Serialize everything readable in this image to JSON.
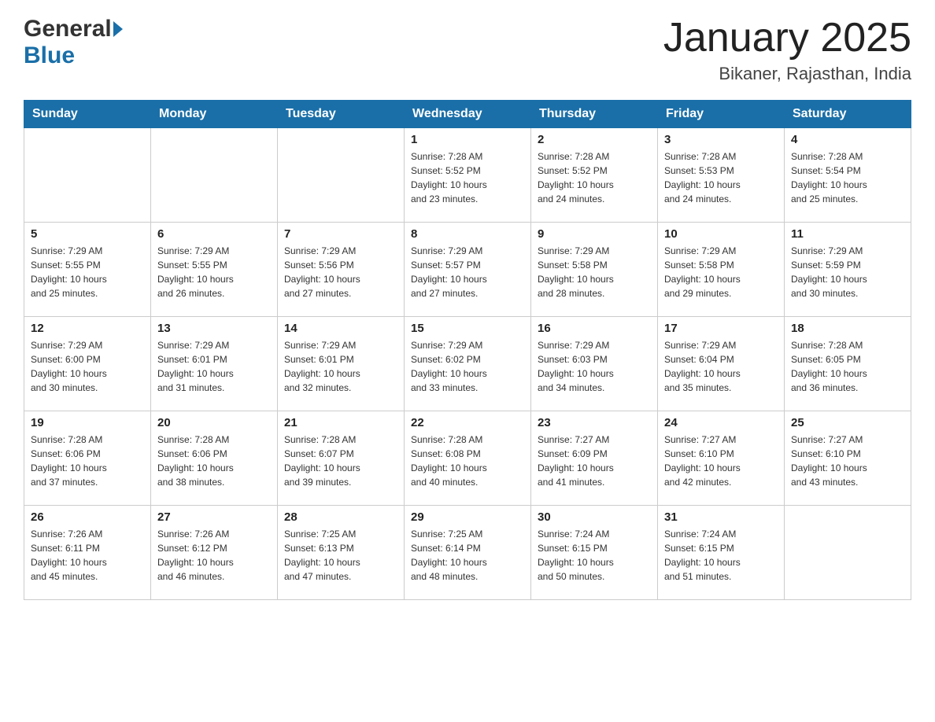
{
  "header": {
    "title": "January 2025",
    "subtitle": "Bikaner, Rajasthan, India",
    "logo_general": "General",
    "logo_blue": "Blue"
  },
  "days_of_week": [
    "Sunday",
    "Monday",
    "Tuesday",
    "Wednesday",
    "Thursday",
    "Friday",
    "Saturday"
  ],
  "weeks": [
    [
      {
        "day": "",
        "info": ""
      },
      {
        "day": "",
        "info": ""
      },
      {
        "day": "",
        "info": ""
      },
      {
        "day": "1",
        "info": "Sunrise: 7:28 AM\nSunset: 5:52 PM\nDaylight: 10 hours\nand 23 minutes."
      },
      {
        "day": "2",
        "info": "Sunrise: 7:28 AM\nSunset: 5:52 PM\nDaylight: 10 hours\nand 24 minutes."
      },
      {
        "day": "3",
        "info": "Sunrise: 7:28 AM\nSunset: 5:53 PM\nDaylight: 10 hours\nand 24 minutes."
      },
      {
        "day": "4",
        "info": "Sunrise: 7:28 AM\nSunset: 5:54 PM\nDaylight: 10 hours\nand 25 minutes."
      }
    ],
    [
      {
        "day": "5",
        "info": "Sunrise: 7:29 AM\nSunset: 5:55 PM\nDaylight: 10 hours\nand 25 minutes."
      },
      {
        "day": "6",
        "info": "Sunrise: 7:29 AM\nSunset: 5:55 PM\nDaylight: 10 hours\nand 26 minutes."
      },
      {
        "day": "7",
        "info": "Sunrise: 7:29 AM\nSunset: 5:56 PM\nDaylight: 10 hours\nand 27 minutes."
      },
      {
        "day": "8",
        "info": "Sunrise: 7:29 AM\nSunset: 5:57 PM\nDaylight: 10 hours\nand 27 minutes."
      },
      {
        "day": "9",
        "info": "Sunrise: 7:29 AM\nSunset: 5:58 PM\nDaylight: 10 hours\nand 28 minutes."
      },
      {
        "day": "10",
        "info": "Sunrise: 7:29 AM\nSunset: 5:58 PM\nDaylight: 10 hours\nand 29 minutes."
      },
      {
        "day": "11",
        "info": "Sunrise: 7:29 AM\nSunset: 5:59 PM\nDaylight: 10 hours\nand 30 minutes."
      }
    ],
    [
      {
        "day": "12",
        "info": "Sunrise: 7:29 AM\nSunset: 6:00 PM\nDaylight: 10 hours\nand 30 minutes."
      },
      {
        "day": "13",
        "info": "Sunrise: 7:29 AM\nSunset: 6:01 PM\nDaylight: 10 hours\nand 31 minutes."
      },
      {
        "day": "14",
        "info": "Sunrise: 7:29 AM\nSunset: 6:01 PM\nDaylight: 10 hours\nand 32 minutes."
      },
      {
        "day": "15",
        "info": "Sunrise: 7:29 AM\nSunset: 6:02 PM\nDaylight: 10 hours\nand 33 minutes."
      },
      {
        "day": "16",
        "info": "Sunrise: 7:29 AM\nSunset: 6:03 PM\nDaylight: 10 hours\nand 34 minutes."
      },
      {
        "day": "17",
        "info": "Sunrise: 7:29 AM\nSunset: 6:04 PM\nDaylight: 10 hours\nand 35 minutes."
      },
      {
        "day": "18",
        "info": "Sunrise: 7:28 AM\nSunset: 6:05 PM\nDaylight: 10 hours\nand 36 minutes."
      }
    ],
    [
      {
        "day": "19",
        "info": "Sunrise: 7:28 AM\nSunset: 6:06 PM\nDaylight: 10 hours\nand 37 minutes."
      },
      {
        "day": "20",
        "info": "Sunrise: 7:28 AM\nSunset: 6:06 PM\nDaylight: 10 hours\nand 38 minutes."
      },
      {
        "day": "21",
        "info": "Sunrise: 7:28 AM\nSunset: 6:07 PM\nDaylight: 10 hours\nand 39 minutes."
      },
      {
        "day": "22",
        "info": "Sunrise: 7:28 AM\nSunset: 6:08 PM\nDaylight: 10 hours\nand 40 minutes."
      },
      {
        "day": "23",
        "info": "Sunrise: 7:27 AM\nSunset: 6:09 PM\nDaylight: 10 hours\nand 41 minutes."
      },
      {
        "day": "24",
        "info": "Sunrise: 7:27 AM\nSunset: 6:10 PM\nDaylight: 10 hours\nand 42 minutes."
      },
      {
        "day": "25",
        "info": "Sunrise: 7:27 AM\nSunset: 6:10 PM\nDaylight: 10 hours\nand 43 minutes."
      }
    ],
    [
      {
        "day": "26",
        "info": "Sunrise: 7:26 AM\nSunset: 6:11 PM\nDaylight: 10 hours\nand 45 minutes."
      },
      {
        "day": "27",
        "info": "Sunrise: 7:26 AM\nSunset: 6:12 PM\nDaylight: 10 hours\nand 46 minutes."
      },
      {
        "day": "28",
        "info": "Sunrise: 7:25 AM\nSunset: 6:13 PM\nDaylight: 10 hours\nand 47 minutes."
      },
      {
        "day": "29",
        "info": "Sunrise: 7:25 AM\nSunset: 6:14 PM\nDaylight: 10 hours\nand 48 minutes."
      },
      {
        "day": "30",
        "info": "Sunrise: 7:24 AM\nSunset: 6:15 PM\nDaylight: 10 hours\nand 50 minutes."
      },
      {
        "day": "31",
        "info": "Sunrise: 7:24 AM\nSunset: 6:15 PM\nDaylight: 10 hours\nand 51 minutes."
      },
      {
        "day": "",
        "info": ""
      }
    ]
  ]
}
